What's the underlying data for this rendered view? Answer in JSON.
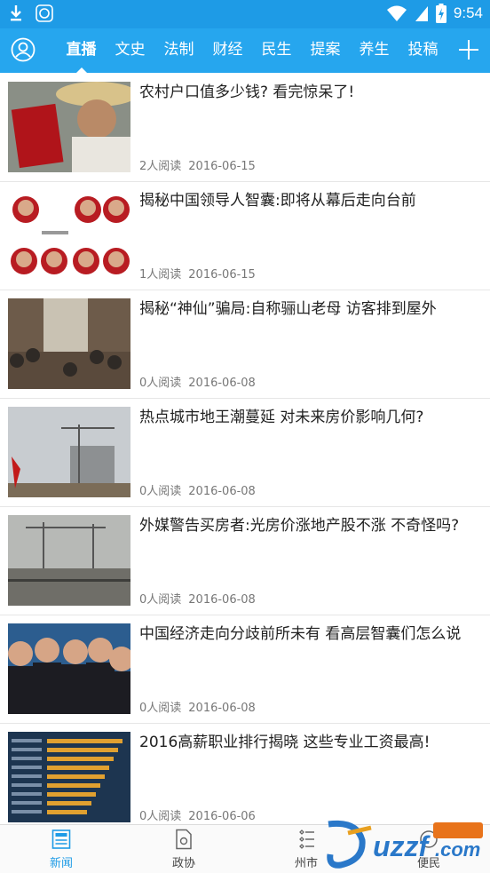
{
  "status_bar": {
    "time": "9:54"
  },
  "nav": {
    "tabs": [
      "直播",
      "文史",
      "法制",
      "财经",
      "民生",
      "提案",
      "养生",
      "投稿"
    ],
    "active_index": 0
  },
  "articles": [
    {
      "title": "农村户口值多少钱? 看完惊呆了!",
      "reads": "2人阅读",
      "date": "2016-06-15",
      "thumb": "passbook-photo"
    },
    {
      "title": "揭秘中国领导人智囊:即将从幕后走向台前",
      "reads": "1人阅读",
      "date": "2016-06-15",
      "thumb": "portrait-grid"
    },
    {
      "title": "揭秘“神仙”骗局:自称骊山老母 访客排到屋外",
      "reads": "0人阅读",
      "date": "2016-06-08",
      "thumb": "crowd-photo"
    },
    {
      "title": "热点城市地王潮蔓延 对未来房价影响几何?",
      "reads": "0人阅读",
      "date": "2016-06-08",
      "thumb": "construction-photo"
    },
    {
      "title": "外媒警告买房者:光房价涨地产股不涨 不奇怪吗?",
      "reads": "0人阅读",
      "date": "2016-06-08",
      "thumb": "cranes-photo"
    },
    {
      "title": "中国经济走向分歧前所未有 看高层智囊们怎么说",
      "reads": "0人阅读",
      "date": "2016-06-08",
      "thumb": "speakers-photo"
    },
    {
      "title": "2016高薪职业排行揭晓 这些专业工资最高!",
      "reads": "0人阅读",
      "date": "2016-06-06",
      "thumb": "salary-bar-chart"
    }
  ],
  "bottom_tabs": [
    {
      "label": "新闻",
      "icon": "news-icon"
    },
    {
      "label": "政协",
      "icon": "document-icon"
    },
    {
      "label": "州市",
      "icon": "city-list-icon"
    },
    {
      "label": "便民",
      "icon": "service-icon"
    }
  ],
  "colors": {
    "status_bar": "#1e9be6",
    "nav_bar": "#26a6ee",
    "active_tab": "#1e9be6"
  }
}
